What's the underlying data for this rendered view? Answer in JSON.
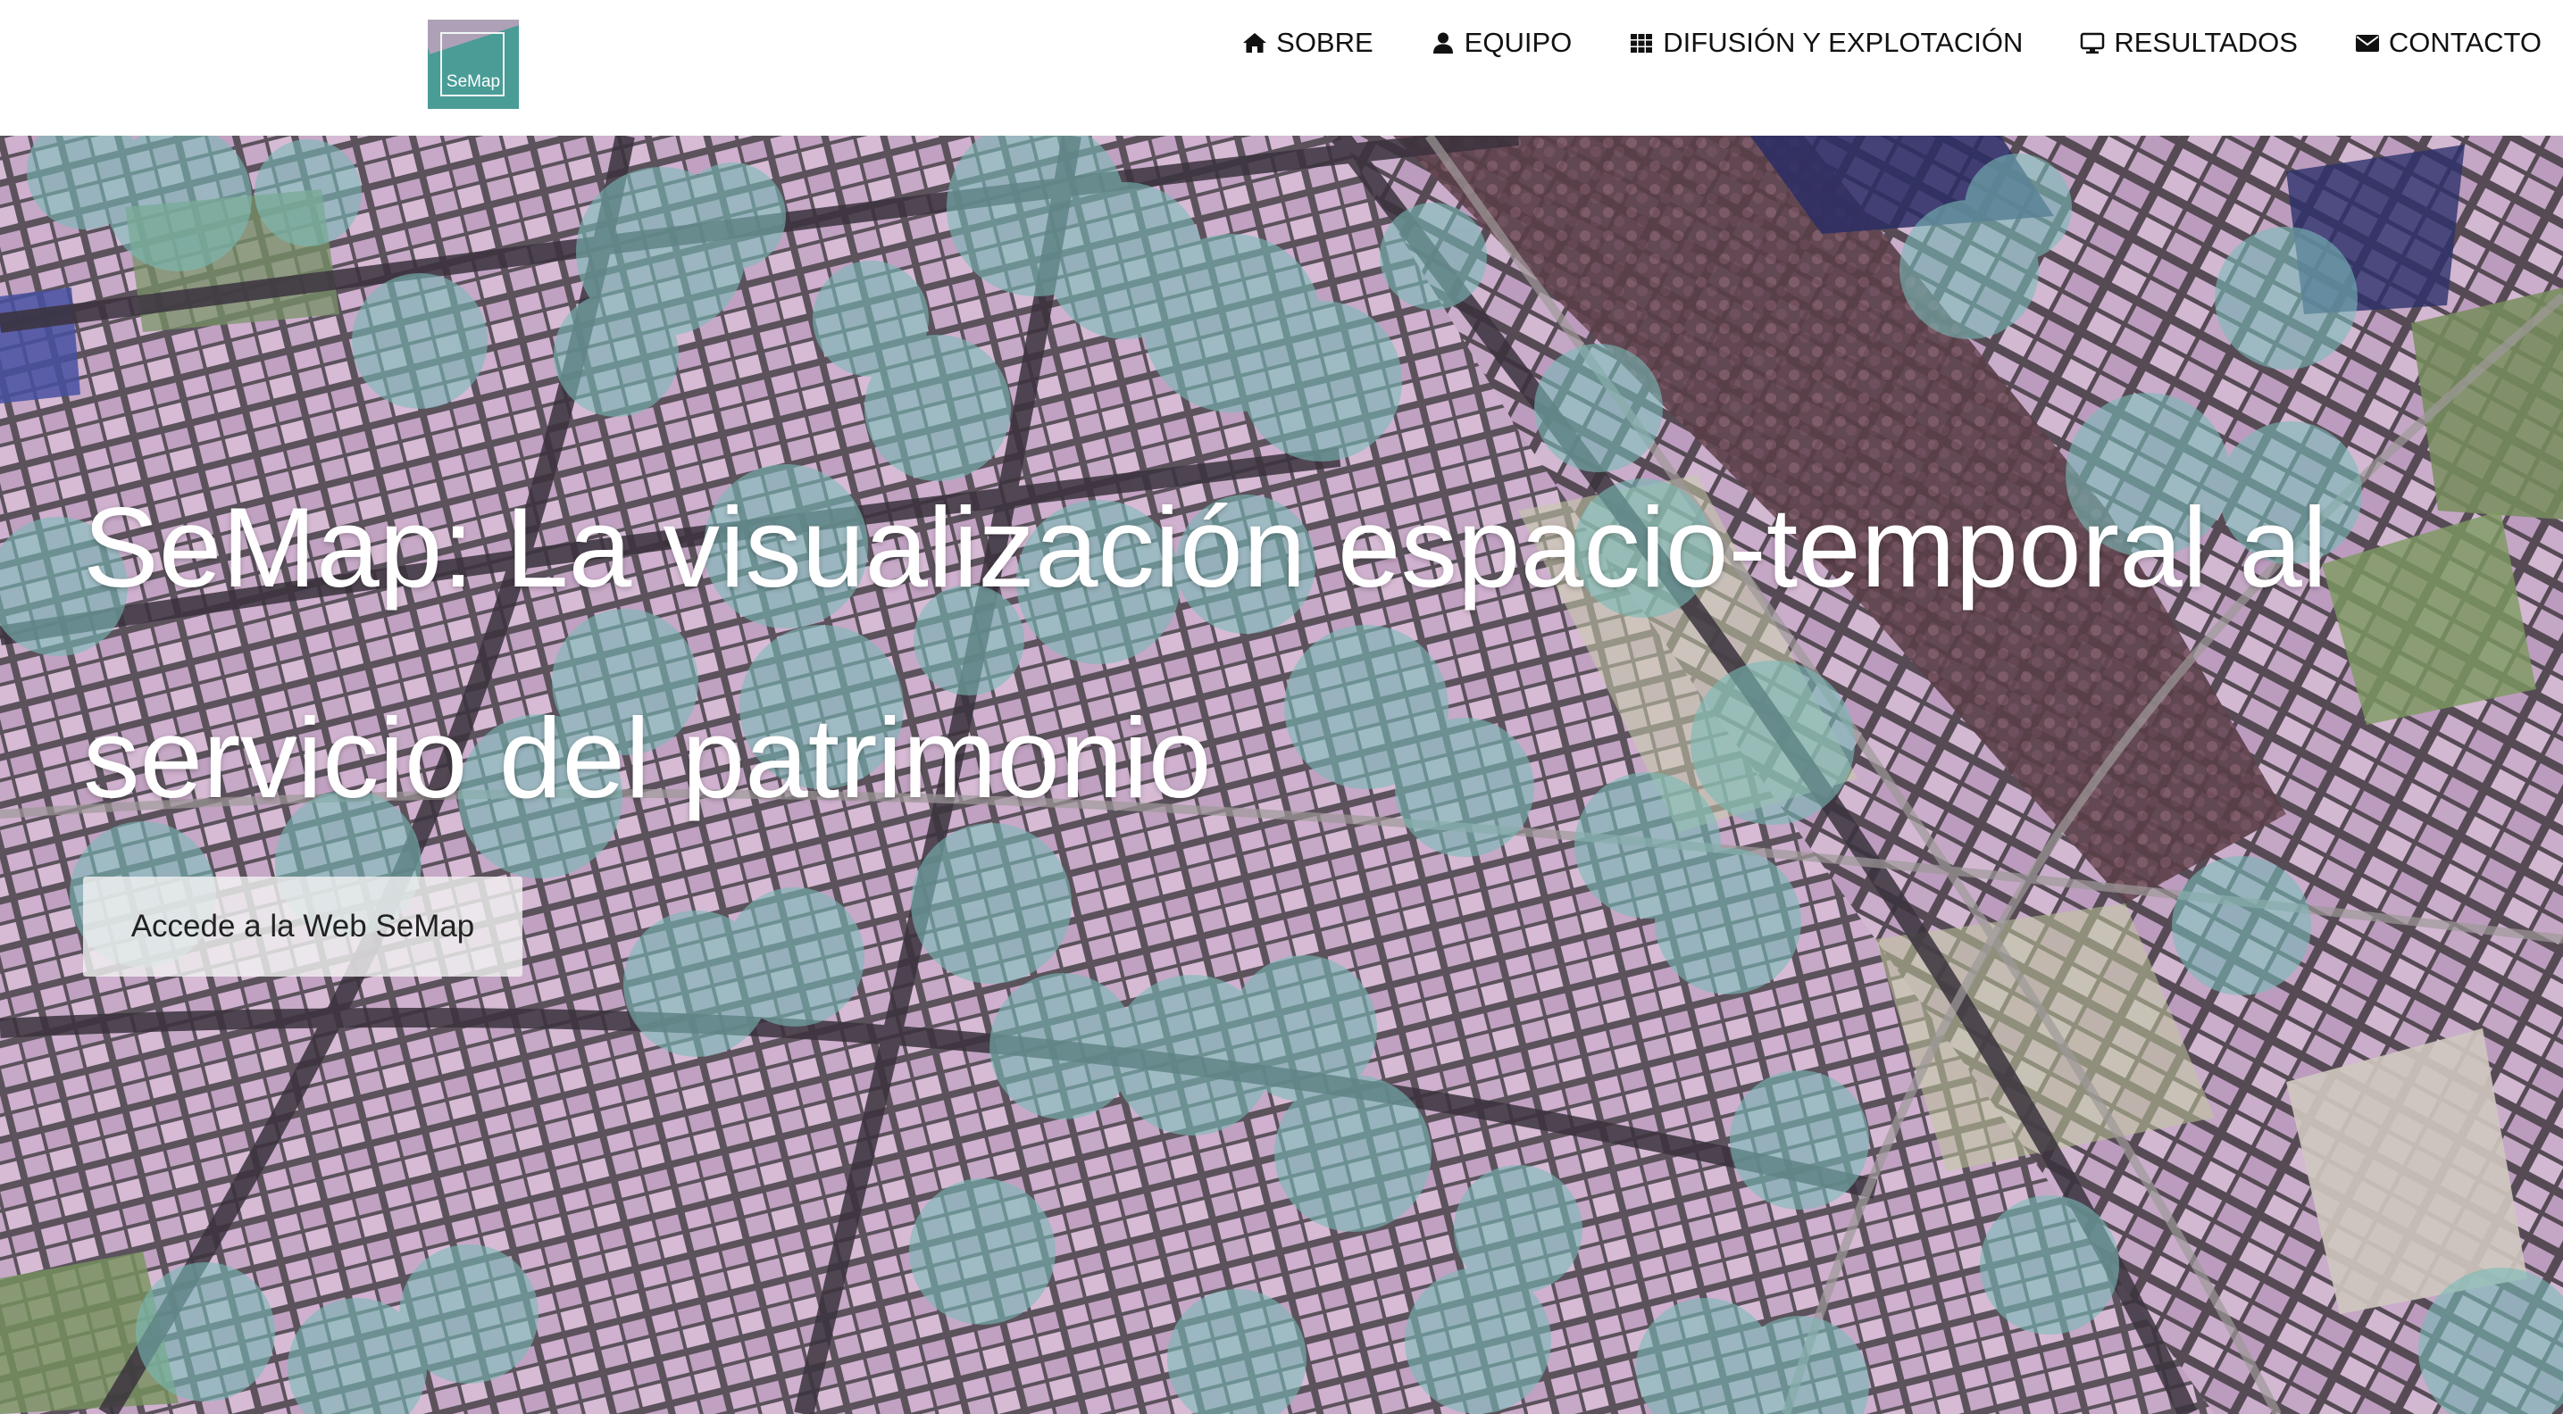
{
  "logo": {
    "text": "SeMap"
  },
  "nav": {
    "items": [
      {
        "label": "SOBRE",
        "icon": "home-icon"
      },
      {
        "label": "EQUIPO",
        "icon": "user-icon"
      },
      {
        "label": "DIFUSIÓN Y EXPLOTACIÓN",
        "icon": "grid-icon"
      },
      {
        "label": "RESULTADOS",
        "icon": "monitor-icon"
      },
      {
        "label": "CONTACTO",
        "icon": "envelope-icon"
      }
    ]
  },
  "hero": {
    "title": "SeMap: La visualización espacio-temporal al servicio del patrimonio",
    "cta_label": "Accede a la Web SeMap",
    "background": "aerial city map with translucent teal circle overlays"
  },
  "colors": {
    "brand_teal": "#4a9c97",
    "overlay_teal": "#7fc3bf",
    "nav_text": "#111111",
    "title_text": "#ffffff"
  }
}
